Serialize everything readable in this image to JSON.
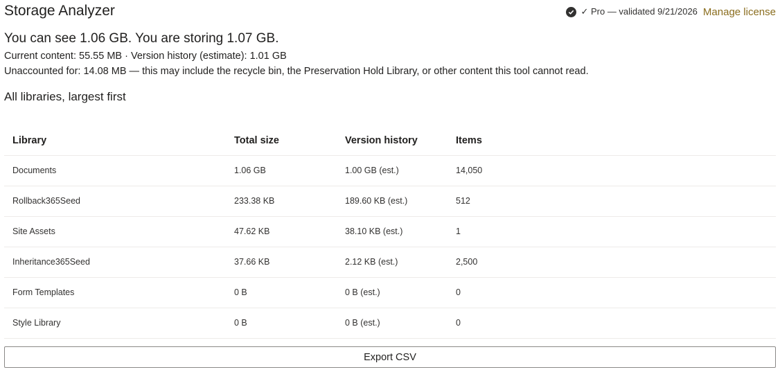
{
  "header": {
    "title": "Storage Analyzer",
    "license_status": "✓ Pro — validated 9/21/2026",
    "manage_license": "Manage license"
  },
  "summary": {
    "headline": "You can see 1.06 GB. You are storing 1.07 GB.",
    "content_line": "Current content: 55.55 MB · Version history (estimate): 1.01 GB",
    "unaccounted_line": "Unaccounted for: 14.08 MB — this may include the recycle bin, the Preservation Hold Library, or other content this tool cannot read."
  },
  "section_title": "All libraries, largest first",
  "table": {
    "columns": [
      "Library",
      "Total size",
      "Version history",
      "Items"
    ],
    "rows": [
      [
        "Documents",
        "1.06 GB",
        "1.00 GB (est.)",
        "14,050"
      ],
      [
        "Rollback365Seed",
        "233.38 KB",
        "189.60 KB (est.)",
        "512"
      ],
      [
        "Site Assets",
        "47.62 KB",
        "38.10 KB (est.)",
        "1"
      ],
      [
        "Inheritance365Seed",
        "37.66 KB",
        "2.12 KB (est.)",
        "2,500"
      ],
      [
        "Form Templates",
        "0 B",
        "0 B (est.)",
        "0"
      ],
      [
        "Style Library",
        "0 B",
        "0 B (est.)",
        "0"
      ]
    ]
  },
  "actions": {
    "export_label": "Export CSV"
  },
  "colors": {
    "link": "#8a6d1e",
    "border": "#edebe9"
  }
}
